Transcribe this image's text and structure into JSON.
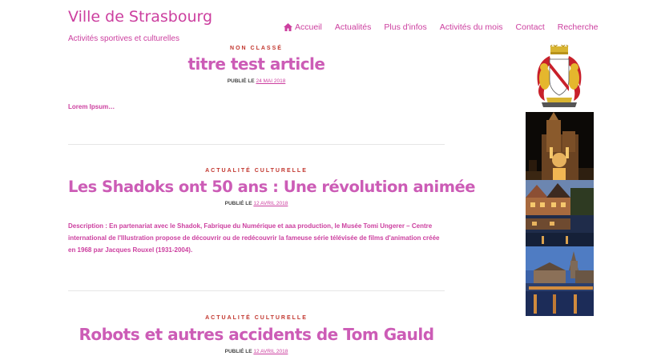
{
  "site": {
    "title": "Ville de Strasbourg",
    "tagline": "Activités sportives et culturelles"
  },
  "nav": {
    "items": [
      {
        "label": "Accueil",
        "icon": "home-icon"
      },
      {
        "label": "Actualités"
      },
      {
        "label": "Plus d'infos"
      },
      {
        "label": "Activités du mois"
      },
      {
        "label": "Contact"
      },
      {
        "label": "Recherche"
      }
    ]
  },
  "posts": [
    {
      "category": "NON CLASSÉ",
      "title": "titre test article",
      "meta_prefix": "PUBLIÉ LE",
      "date": "24 MAI 2018",
      "excerpt": "Lorem Ipsum…"
    },
    {
      "category": "ACTUALITÉ CULTURELLE",
      "title": "Les Shadoks ont 50 ans : Une révolution animée",
      "meta_prefix": "PUBLIÉ LE",
      "date": "12 AVRIL 2018",
      "excerpt": "Description : En partenariat avec le Shadok, Fabrique du Numérique et aaa production, le Musée Tomi Ungerer – Centre international de l'Illustration propose de découvrir ou de redécouvrir la fameuse série télévisée de films d'animation créée en 1968 par Jacques Rouxel (1931-2004)."
    },
    {
      "category": "ACTUALITÉ CULTURELLE",
      "title": "Robots et autres accidents de Tom Gauld",
      "meta_prefix": "PUBLIÉ LE",
      "date": "12 AVRIL 2018",
      "excerpt": ""
    }
  ],
  "colors": {
    "accent": "#cc3f9f",
    "title": "#cc5cb6",
    "category": "#c2352d"
  },
  "sidebar": {
    "images": [
      "coat-of-arms-icon",
      "cathedral-night-photo",
      "petite-france-photo",
      "ponts-couverts-photo"
    ]
  }
}
